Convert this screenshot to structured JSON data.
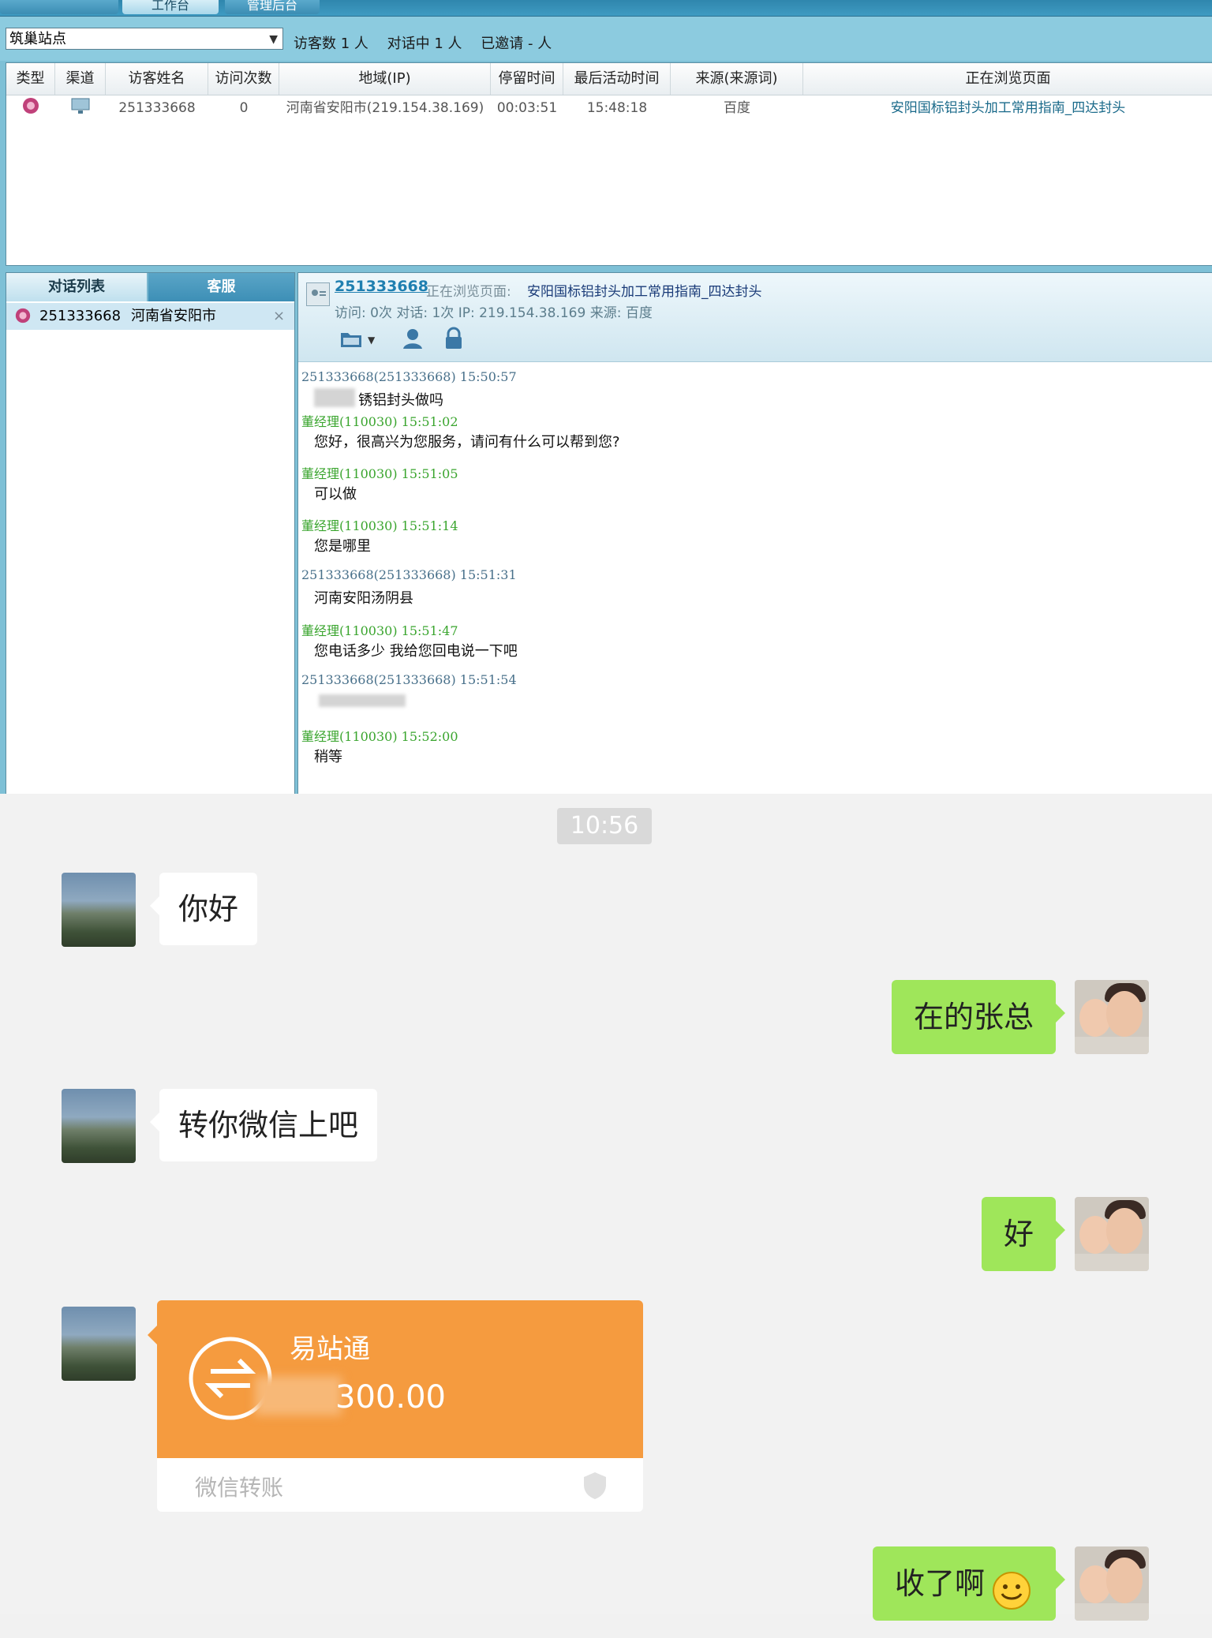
{
  "app": {
    "tabs": [
      "工作台",
      "管理后台"
    ],
    "site_select": "筑巢站点",
    "stats": {
      "visitors": "访客数 1 人",
      "chatting": "对话中 1 人",
      "invited": "已邀请 - 人"
    },
    "visitor_table": {
      "headers": [
        "类型",
        "渠道",
        "访客姓名",
        "访问次数",
        "地域(IP)",
        "停留时间",
        "最后活动时间",
        "来源(来源词)",
        "正在浏览页面"
      ],
      "row": {
        "name": "251333668",
        "visits": "0",
        "region": "河南省安阳市(219.154.38.169)",
        "stay": "00:03:51",
        "last_active": "15:48:18",
        "source": "百度",
        "page": "安阳国标铝封头加工常用指南_四达封头"
      }
    },
    "conv_tabs": [
      "对话列表",
      "客服"
    ],
    "conv_item": {
      "id": "251333668",
      "location": "河南省安阳市",
      "close": "×"
    },
    "chat_header": {
      "visitor_id": "251333668",
      "browsing_label": "正在浏览页面:",
      "browsing_page": "安阳国标铝封头加工常用指南_四达封头",
      "visit_info": "访问: 0次 对话: 1次 IP: 219.154.38.169 来源: 百度"
    },
    "messages": [
      {
        "from": "visitor",
        "meta": "251333668(251333668)  15:50:57",
        "text": "锈铝封头做吗"
      },
      {
        "from": "staff",
        "name": "董经理",
        "meta": "(110030)  15:51:02",
        "text": "您好，很高兴为您服务，请问有什么可以帮到您?"
      },
      {
        "from": "staff",
        "name": "董经理",
        "meta": "(110030)  15:51:05",
        "text": "可以做"
      },
      {
        "from": "staff",
        "name": "董经理",
        "meta": "(110030)  15:51:14",
        "text": "您是哪里"
      },
      {
        "from": "visitor",
        "meta": "251333668(251333668)  15:51:31",
        "text": "河南安阳汤阴县"
      },
      {
        "from": "staff",
        "name": "董经理",
        "meta": "(110030)  15:51:47",
        "text": "您电话多少 我给您回电说一下吧"
      },
      {
        "from": "visitor",
        "meta": "251333668(251333668)  15:51:54",
        "text": ""
      },
      {
        "from": "staff",
        "name": "董经理",
        "meta": "(110030)  15:52:00",
        "text": "稍等"
      }
    ]
  },
  "wechat": {
    "time": "10:56",
    "messages": [
      {
        "side": "left",
        "text": "你好"
      },
      {
        "side": "right",
        "text": "在的张总"
      },
      {
        "side": "left",
        "text": "转你微信上吧"
      },
      {
        "side": "right",
        "text": "好"
      },
      {
        "side": "right",
        "text": "收了啊"
      }
    ],
    "transfer": {
      "title": "易站通",
      "amount": "300.00",
      "footer": "微信转账"
    }
  }
}
